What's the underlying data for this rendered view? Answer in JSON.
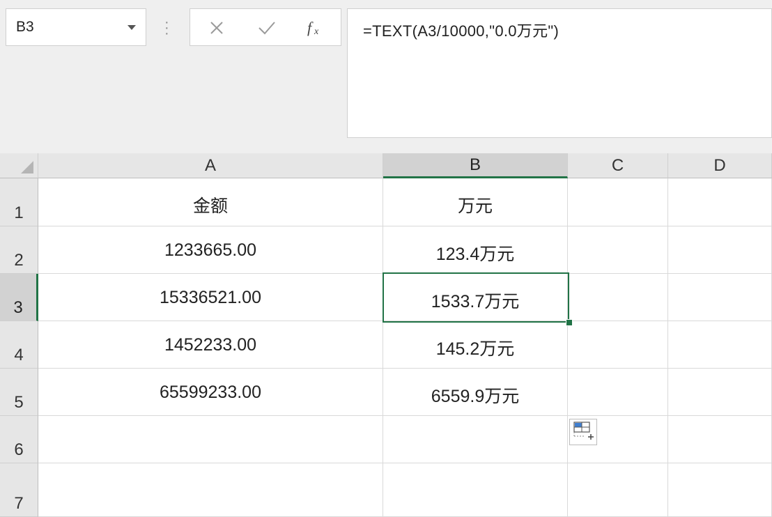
{
  "name_box": {
    "value": "B3"
  },
  "formula_bar": {
    "formula": "=TEXT(A3/10000,\"0.0万元\")",
    "cancel_icon": "close-icon",
    "enter_icon": "check-icon",
    "function_icon": "fx-icon"
  },
  "columns": [
    "A",
    "B",
    "C",
    "D"
  ],
  "rows": [
    "1",
    "2",
    "3",
    "4",
    "5",
    "6",
    "7"
  ],
  "cells": {
    "A1": "金额",
    "B1": "万元",
    "A2": "1233665.00",
    "B2": "123.4万元",
    "A3": "15336521.00",
    "B3": "1533.7万元",
    "A4": "1452233.00",
    "B4": "145.2万元",
    "A5": "65599233.00",
    "B5": "6559.9万元"
  },
  "selection": {
    "cell": "B3",
    "accent_color": "#217346"
  },
  "quick_analysis": {
    "icon": "quick-analysis-icon"
  }
}
